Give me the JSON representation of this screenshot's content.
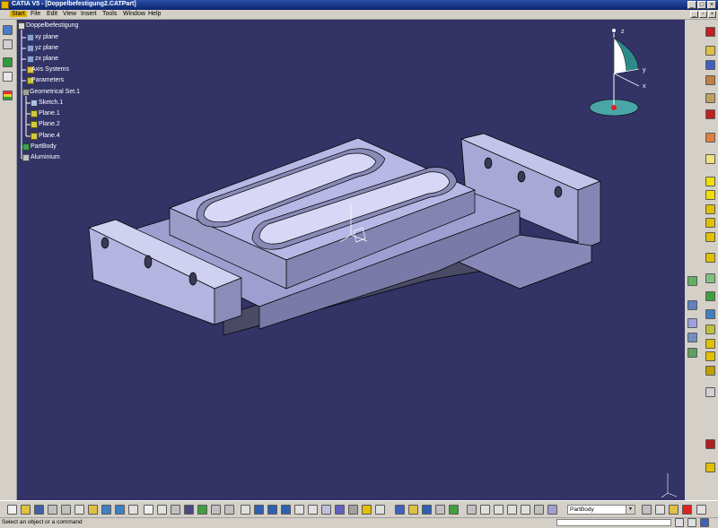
{
  "window": {
    "title": "CATIA V5 - [Doppelbefestigung2.CATPart]"
  },
  "menu": {
    "items": [
      "Start",
      "File",
      "Edit",
      "View",
      "Insert",
      "Tools",
      "Window",
      "Help"
    ]
  },
  "tree": {
    "items": [
      {
        "label": "Doppelbefestigung",
        "icon": "part-document-icon"
      },
      {
        "label": "xy plane",
        "icon": "plane-icon"
      },
      {
        "label": "yz plane",
        "icon": "plane-icon"
      },
      {
        "label": "zx plane",
        "icon": "plane-icon"
      },
      {
        "label": "Axis Systems",
        "icon": "axis-system-icon"
      },
      {
        "label": "Parameters",
        "icon": "parameters-icon"
      },
      {
        "label": "Geometrical Set.1",
        "icon": "geometrical-set-icon"
      },
      {
        "label": "Sketch.1",
        "icon": "sketch-icon"
      },
      {
        "label": "Plane.1",
        "icon": "plane-icon"
      },
      {
        "label": "Plane.2",
        "icon": "plane-icon"
      },
      {
        "label": "Plane.4",
        "icon": "plane-icon"
      },
      {
        "label": "PartBody",
        "icon": "partbody-icon"
      },
      {
        "label": "Aluminium",
        "icon": "material-icon"
      }
    ]
  },
  "compass": {
    "x": "x",
    "y": "y",
    "z": "z"
  },
  "toolbar": {
    "body_select": "PartBody"
  },
  "status": {
    "message": "Select an object or a command"
  },
  "colors": {
    "viewport": "#333366",
    "part": "#b4b4e0",
    "tree_text": "#ffffff",
    "start_menu": "#e2b400"
  }
}
